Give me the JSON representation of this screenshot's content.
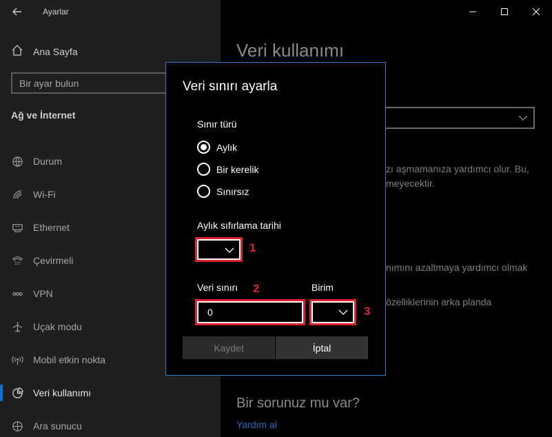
{
  "window": {
    "app_title": "Ayarlar",
    "controls": {
      "minimize": "─",
      "maximize": "☐",
      "close": "✕"
    }
  },
  "sidebar": {
    "home_label": "Ana Sayfa",
    "search_placeholder": "Bir ayar bulun",
    "section_title": "Ağ ve İnternet",
    "items": [
      {
        "label": "Durum",
        "icon": "globe-icon",
        "active": false
      },
      {
        "label": "Wi-Fi",
        "icon": "wifi-icon",
        "active": false
      },
      {
        "label": "Ethernet",
        "icon": "ethernet-icon",
        "active": false
      },
      {
        "label": "Çevirmeli",
        "icon": "dialup-icon",
        "active": false
      },
      {
        "label": "VPN",
        "icon": "vpn-icon",
        "active": false
      },
      {
        "label": "Uçak modu",
        "icon": "airplane-icon",
        "active": false
      },
      {
        "label": "Mobil etkin nokta",
        "icon": "hotspot-icon",
        "active": false
      },
      {
        "label": "Veri kullanımı",
        "icon": "data-usage-icon",
        "active": true
      },
      {
        "label": "Ara sunucu",
        "icon": "proxy-icon",
        "active": false
      }
    ]
  },
  "content": {
    "page_title": "Veri kullanımı",
    "bg_text_1": "zı aşmamanıza yardımcı olur. Bu,",
    "bg_text_2": "meyecektir.",
    "bg_text_3": "nımını azaltmaya yardımcı olmak",
    "bg_text_4": "özelliklerinin arka planda",
    "help_question": "Bir sorunuz mu var?",
    "help_link": "Yardım al"
  },
  "dialog": {
    "title": "Veri sınırı ayarla",
    "limit_type_label": "Sınır türü",
    "options": [
      {
        "label": "Aylık",
        "selected": true
      },
      {
        "label": "Bir kerelik",
        "selected": false
      },
      {
        "label": "Sınırsız",
        "selected": false
      }
    ],
    "reset_date_label": "Aylık sıfırlama tarihi",
    "reset_date_value": "",
    "data_limit_label": "Veri sınırı",
    "data_limit_value": "0",
    "unit_label": "Birim",
    "unit_value": "",
    "save_label": "Kaydet",
    "cancel_label": "İptal"
  },
  "annotations": {
    "marker_1": "1",
    "marker_2": "2",
    "marker_3": "3",
    "color": "#e0202a"
  },
  "colors": {
    "accent": "#0a6fd6",
    "dialog_border": "#2d7fd1",
    "link": "#1b6ec2"
  }
}
